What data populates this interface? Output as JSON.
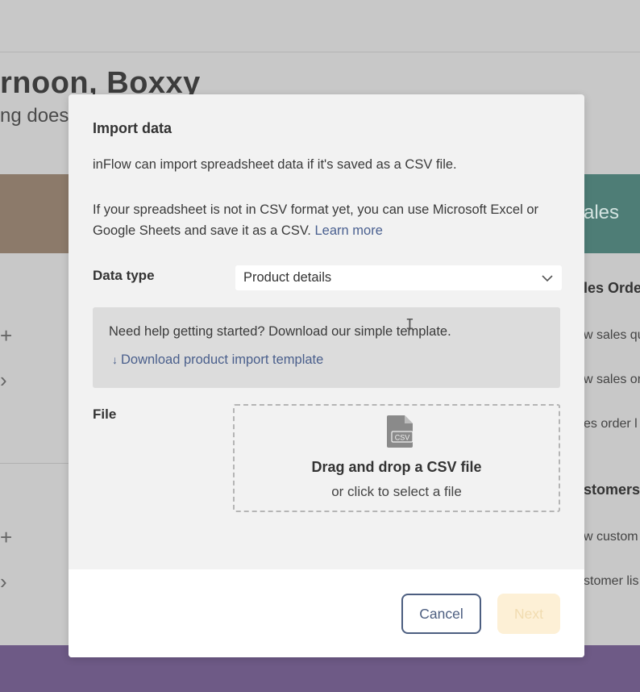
{
  "background": {
    "greeting": "rnoon, Boxxy",
    "subtitle": "ng doesn",
    "teal_card_label": "ales",
    "sales_orders_heading": "les Orde",
    "sales_links": [
      "w sales qu",
      "w sales or",
      "es order l"
    ],
    "customers_heading": "stomers",
    "customer_links": [
      "w custom",
      "stomer lis"
    ],
    "icons": {
      "plus": "plus-icon",
      "chevron_right": "chevron-right-icon"
    }
  },
  "modal": {
    "title": "Import data",
    "intro": "inFlow can import spreadsheet data if it's saved as a CSV file.",
    "csv_help": "If your spreadsheet is not in CSV format yet, you can use Microsoft Excel or Google Sheets and save it as a CSV.",
    "learn_more": "Learn more",
    "data_type_label": "Data type",
    "data_type_value": "Product details",
    "help_text": "Need help getting started? Download our simple template.",
    "download_link": "Download product import template",
    "download_icon": "download-arrow-icon",
    "file_label": "File",
    "csv_icon_text": "CSV",
    "dropzone_title": "Drag and drop a CSV file",
    "dropzone_subtitle": "or click to select a file",
    "cancel_label": "Cancel",
    "next_label": "Next"
  },
  "colors": {
    "accent": "#4c5e80",
    "link": "#4a5f8c",
    "next_disabled_bg": "#fdf0d6",
    "teal": "#4e7d76",
    "purple": "#6e5a86"
  }
}
